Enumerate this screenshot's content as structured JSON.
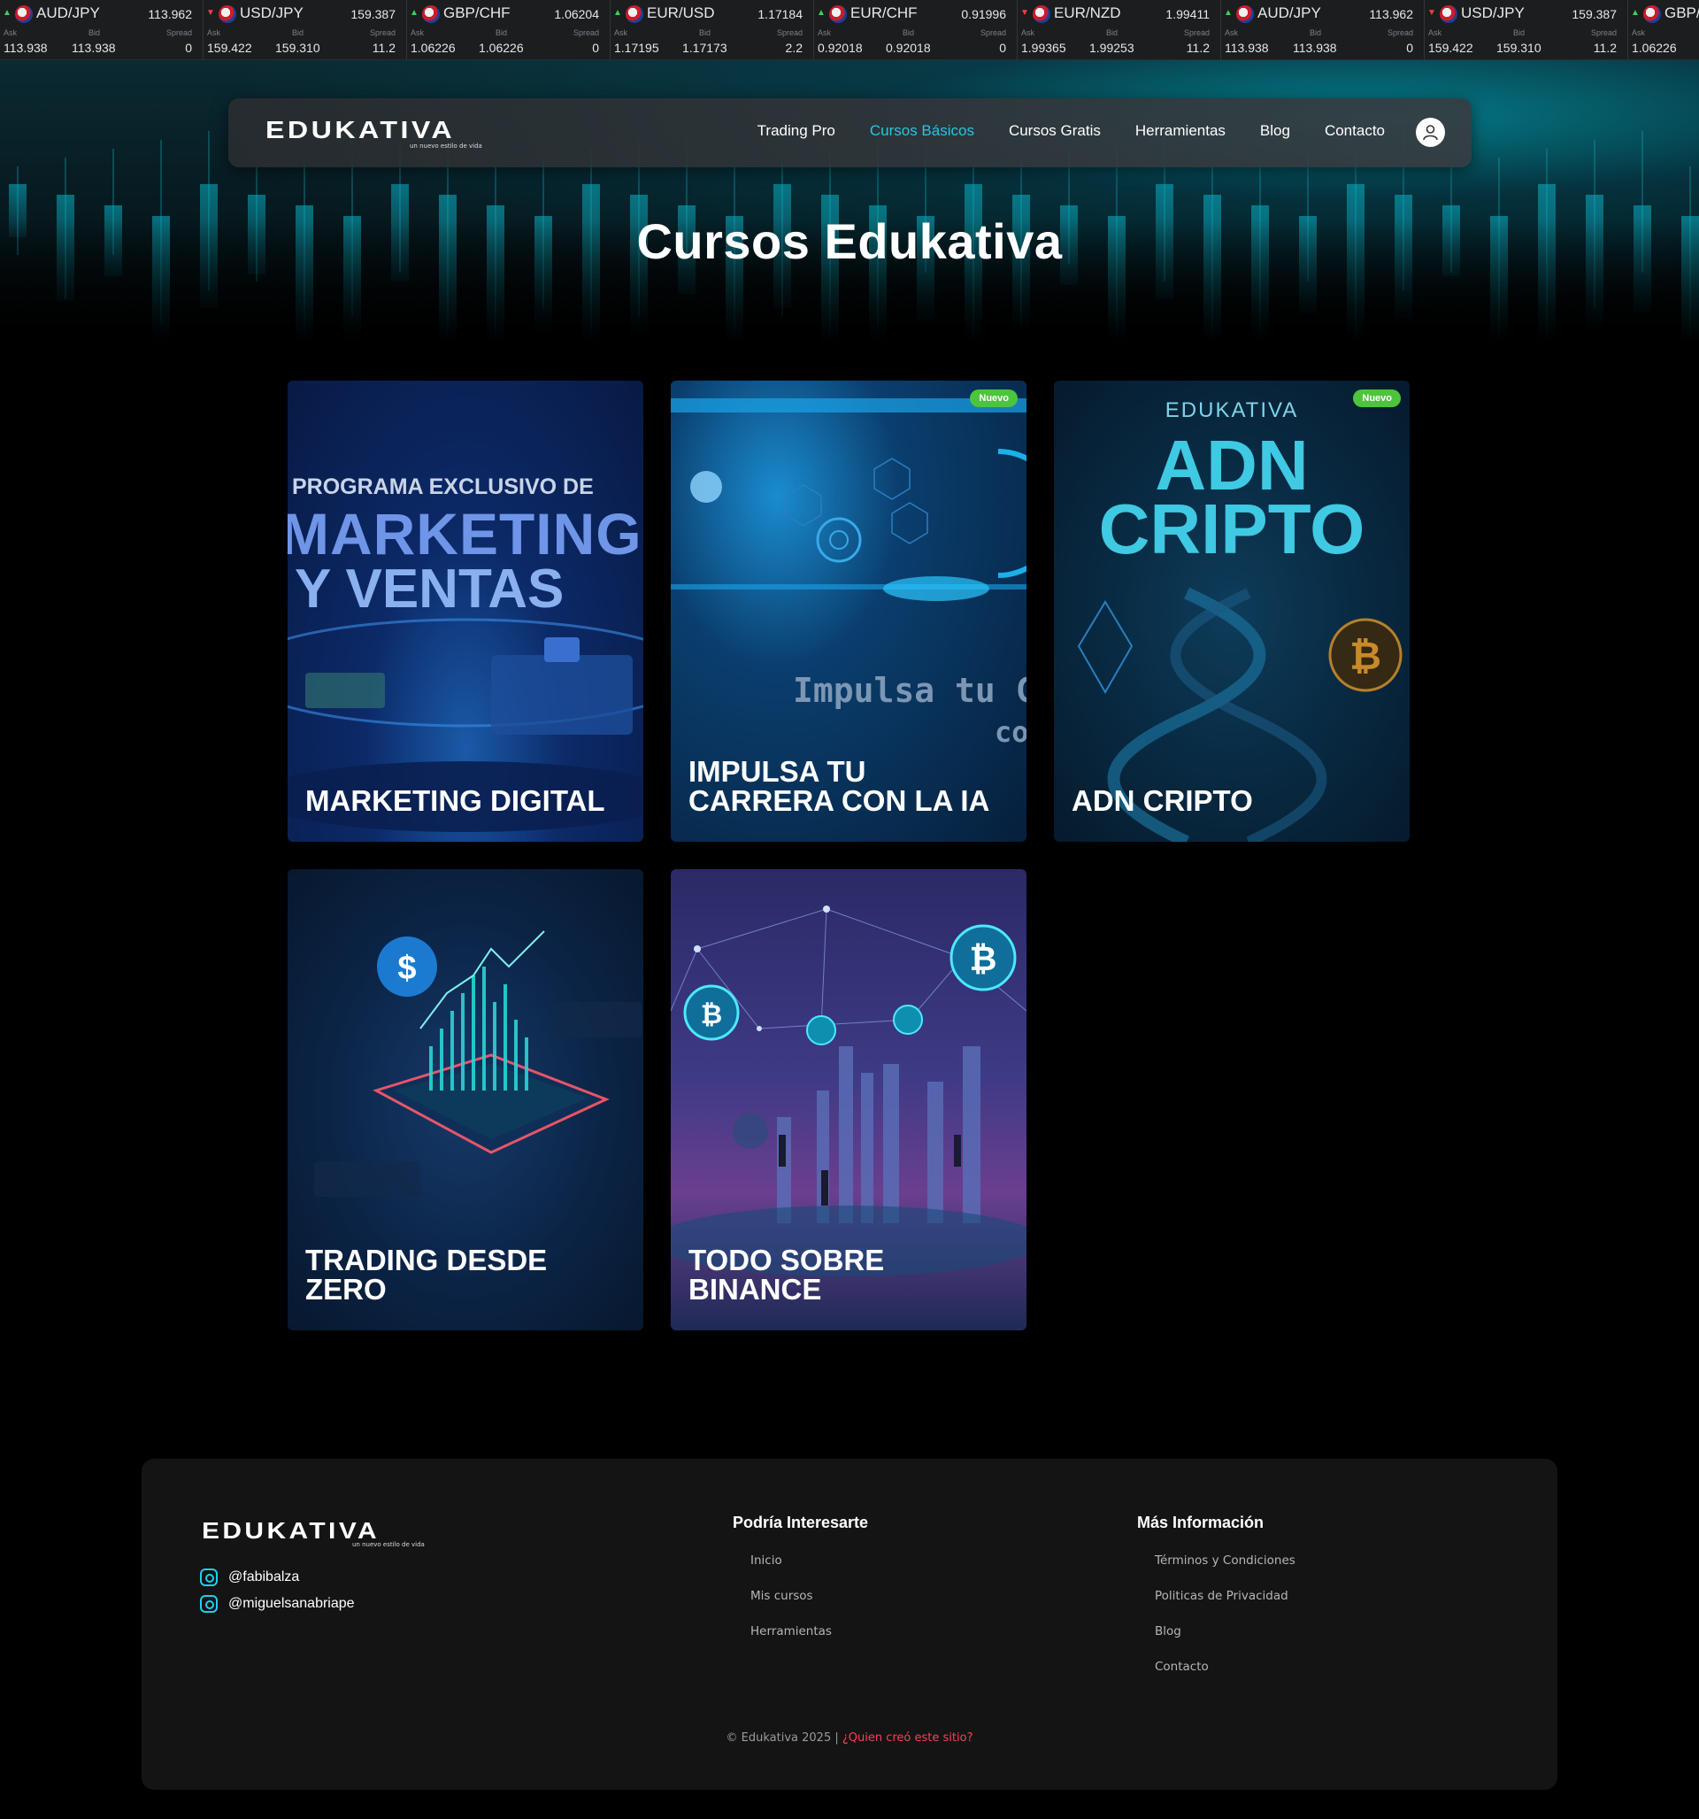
{
  "ticker": [
    {
      "pair": "AUD/JPY",
      "price": "113.962",
      "dir": "up",
      "ask": "113.938",
      "bid": "113.938",
      "spread": "0"
    },
    {
      "pair": "USD/JPY",
      "price": "159.387",
      "dir": "down",
      "ask": "159.422",
      "bid": "159.310",
      "spread": "11.2"
    },
    {
      "pair": "GBP/CHF",
      "price": "1.06204",
      "dir": "up",
      "ask": "1.06226",
      "bid": "1.06226",
      "spread": "0"
    },
    {
      "pair": "EUR/USD",
      "price": "1.17184",
      "dir": "up",
      "ask": "1.17195",
      "bid": "1.17173",
      "spread": "2.2"
    },
    {
      "pair": "EUR/CHF",
      "price": "0.91996",
      "dir": "up",
      "ask": "0.92018",
      "bid": "0.92018",
      "spread": "0"
    },
    {
      "pair": "EUR/NZD",
      "price": "1.99411",
      "dir": "down",
      "ask": "1.99365",
      "bid": "1.99253",
      "spread": "11.2"
    },
    {
      "pair": "AUD/JPY",
      "price": "113.962",
      "dir": "up",
      "ask": "113.938",
      "bid": "113.938",
      "spread": "0"
    },
    {
      "pair": "USD/JPY",
      "price": "159.387",
      "dir": "down",
      "ask": "159.422",
      "bid": "159.310",
      "spread": "11.2"
    },
    {
      "pair": "GBP/",
      "price": "",
      "dir": "up",
      "ask": "1.06226",
      "bid": "",
      "spread": ""
    }
  ],
  "ticker_labels": {
    "ask": "Ask",
    "bid": "Bid",
    "spread": "Spread"
  },
  "brand": {
    "name": "EDUKATIVA",
    "tagline": "un nuevo estilo de vida"
  },
  "nav": {
    "items": [
      "Trading Pro",
      "Cursos Básicos",
      "Cursos Gratis",
      "Herramientas",
      "Blog",
      "Contacto"
    ],
    "active": "Cursos Básicos"
  },
  "page": {
    "title": "Cursos Edukativa"
  },
  "courses": [
    {
      "title": "MARKETING DIGITAL",
      "badge": "",
      "art": [
        "PROGRAMA EXCLUSIVO DE",
        "MARKETING",
        "Y VENTAS"
      ]
    },
    {
      "title": "IMPULSA TU CARRERA CON LA IA",
      "badge": "Nuevo",
      "art": [
        "Impulsa tu C",
        "co"
      ]
    },
    {
      "title": "ADN CRIPTO",
      "badge": "Nuevo",
      "art": [
        "EDUKATIVA",
        "ADN",
        "CRIPTO"
      ]
    },
    {
      "title": "TRADING DESDE ZERO",
      "badge": "",
      "art": []
    },
    {
      "title": "TODO SOBRE BINANCE",
      "badge": "",
      "art": []
    }
  ],
  "footer": {
    "socials": [
      "@fabibalza",
      "@miguelsanabriape"
    ],
    "col1": {
      "heading": "Podría Interesarte",
      "links": [
        "Inicio",
        "Mis cursos",
        "Herramientas"
      ]
    },
    "col2": {
      "heading": "Más Información",
      "links": [
        "Términos y Condiciones",
        "Politicas de Privacidad",
        "Blog",
        "Contacto"
      ]
    },
    "copyright": "© Edukativa 2025 | ",
    "credit_link": "¿Quien creó este sitio?"
  },
  "colors": {
    "accent": "#28c6e0",
    "badge": "#4cc43c",
    "credit": "#ff3c5a"
  }
}
